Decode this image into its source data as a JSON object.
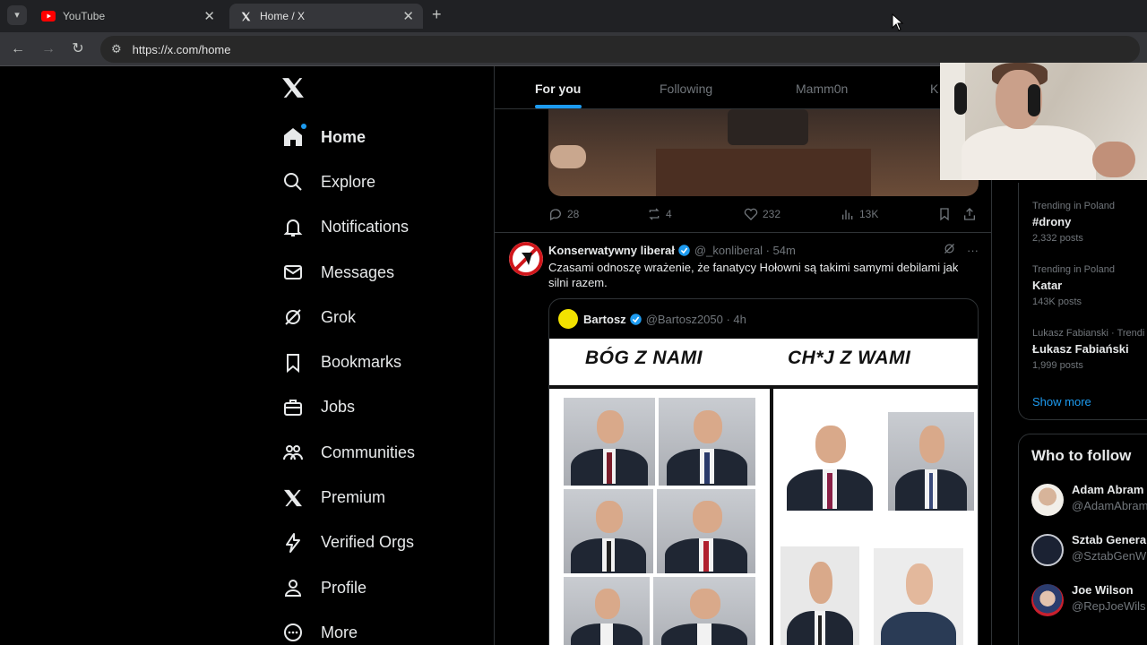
{
  "browser": {
    "tabs": [
      {
        "title": "YouTube",
        "favicon": "youtube-icon",
        "active": false
      },
      {
        "title": "Home / X",
        "favicon": "x-logo-icon",
        "active": true
      }
    ],
    "url": "https://x.com/home"
  },
  "sidebar": {
    "items": [
      {
        "label": "Home",
        "icon": "home-icon",
        "active": true
      },
      {
        "label": "Explore",
        "icon": "search-icon"
      },
      {
        "label": "Notifications",
        "icon": "bell-icon"
      },
      {
        "label": "Messages",
        "icon": "envelope-icon"
      },
      {
        "label": "Grok",
        "icon": "grok-icon"
      },
      {
        "label": "Bookmarks",
        "icon": "bookmark-icon"
      },
      {
        "label": "Jobs",
        "icon": "briefcase-icon"
      },
      {
        "label": "Communities",
        "icon": "people-icon"
      },
      {
        "label": "Premium",
        "icon": "x-logo-icon"
      },
      {
        "label": "Verified Orgs",
        "icon": "lightning-icon"
      },
      {
        "label": "Profile",
        "icon": "person-icon"
      },
      {
        "label": "More",
        "icon": "more-circle-icon"
      }
    ]
  },
  "feed": {
    "tabs": [
      "For you",
      "Following",
      "Mamm0n",
      "K"
    ],
    "prev_post_actions": {
      "replies": "28",
      "reposts": "4",
      "likes": "232",
      "views": "13K"
    },
    "post": {
      "name": "Konserwatywny liberał",
      "handle_time": "@_konliberal · 54m",
      "text": "Czasami odnoszę wrażenie, że fanatycy Hołowni są takimi samymi debilami jak silni razem.",
      "quote": {
        "name": "Bartosz",
        "handle_time": "@Bartosz2050 · 4h",
        "meme_left": "BÓG Z NAMI",
        "meme_right": "CH*J Z WAMI"
      }
    }
  },
  "trends": [
    {
      "context": "Trending in Poland",
      "title": "#drony",
      "count": "2,332 posts"
    },
    {
      "context": "Trending in Poland",
      "title": "Katar",
      "count": "143K posts"
    },
    {
      "context": "Lukasz Fabianski · Trendi",
      "title": "Łukasz Fabiański",
      "count": "1,999 posts"
    }
  ],
  "trends_show_more": "Show more",
  "who_to_follow": {
    "title": "Who to follow",
    "accounts": [
      {
        "name": "Adam Abram",
        "handle": "@AdamAbram"
      },
      {
        "name": "Sztab Genera",
        "handle": "@SztabGenW"
      },
      {
        "name": "Joe Wilson",
        "handle": "@RepJoeWils"
      }
    ]
  },
  "colors": {
    "accent": "#1d9bf0",
    "background": "#000000",
    "text": "#e7e9ea",
    "muted": "#71767b",
    "border": "#2f3336"
  }
}
